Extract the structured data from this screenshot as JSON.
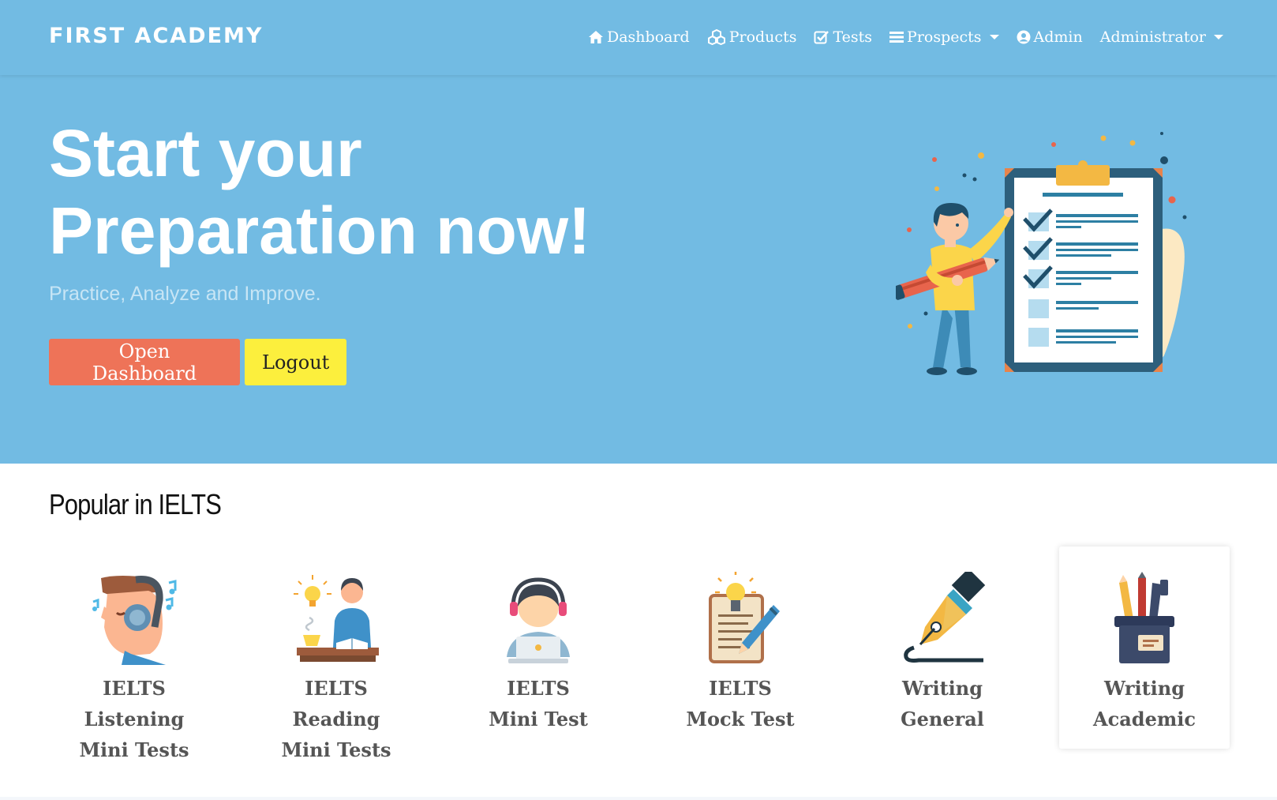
{
  "navbar": {
    "brand": "FIRST ACADEMY",
    "items": [
      {
        "label": "Dashboard",
        "icon": "home-icon"
      },
      {
        "label": "Products",
        "icon": "cubes-icon"
      },
      {
        "label": "Tests",
        "icon": "check-square-icon"
      },
      {
        "label": "Prospects",
        "icon": "list-icon",
        "dropdown": true
      },
      {
        "label": "Admin",
        "icon": "user-circle-icon"
      },
      {
        "label": "Administrator",
        "dropdown": true
      }
    ]
  },
  "hero": {
    "title_line1": "Start your",
    "title_line2": "Preparation now!",
    "subtitle": "Practice, Analyze and Improve.",
    "primary_button": "Open Dashboard",
    "secondary_button": "Logout",
    "illustration": "student-checklist-illustration"
  },
  "popular": {
    "heading": "Popular in IELTS",
    "items": [
      {
        "label": "IELTS\nListening\nMini Tests",
        "icon": "listening-headphones-icon"
      },
      {
        "label": "IELTS\nReading\nMini Tests",
        "icon": "reading-desk-icon"
      },
      {
        "label": "IELTS\nMini Test",
        "icon": "laptop-headset-icon"
      },
      {
        "label": "IELTS\nMock Test",
        "icon": "notepad-pen-icon"
      },
      {
        "label": "Writing\nGeneral",
        "icon": "fountain-pen-icon"
      },
      {
        "label": "Writing\nAcademic",
        "icon": "pencil-cup-icon"
      }
    ]
  },
  "colors": {
    "hero_bg": "#72bbe3",
    "primary_button": "#ee7358",
    "secondary_button": "#fcef3d"
  }
}
